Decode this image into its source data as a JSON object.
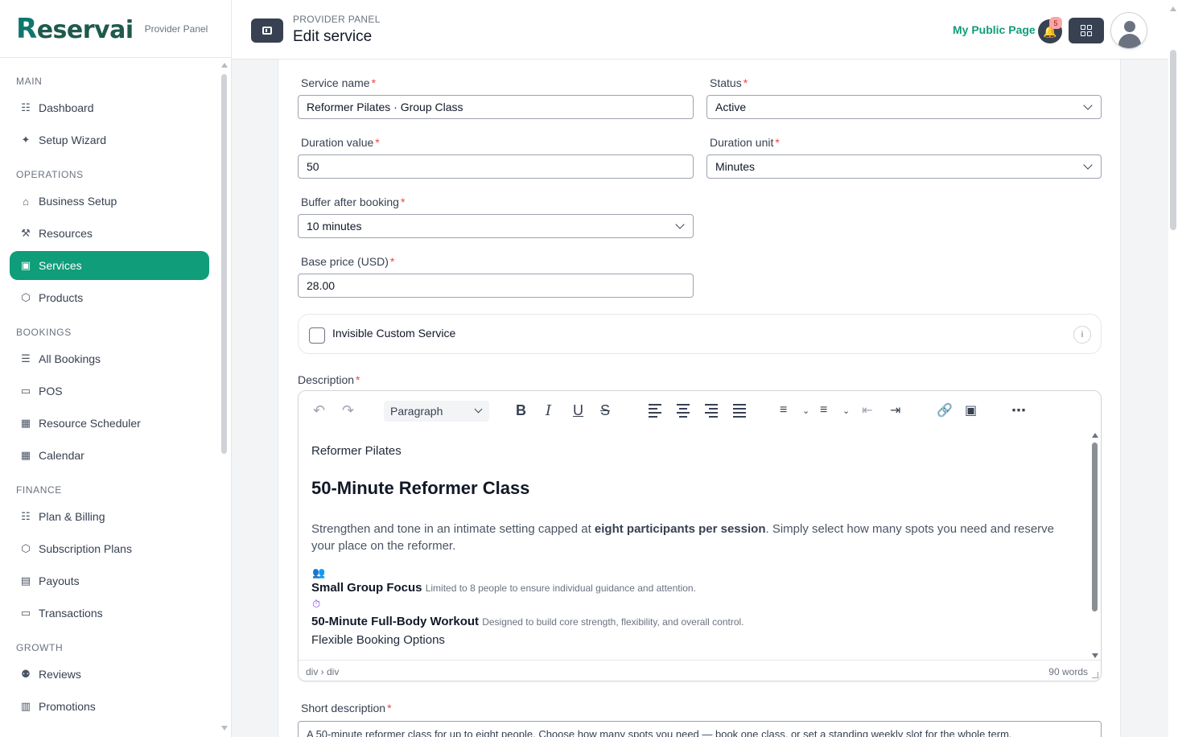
{
  "brand": {
    "logo": "Reservai",
    "subtitle": "Provider Panel"
  },
  "sidebar": {
    "sections": [
      {
        "title": "MAIN",
        "items": [
          {
            "label": "Dashboard",
            "icon": "grid-icon"
          },
          {
            "label": "Setup Wizard",
            "icon": "wand-icon"
          }
        ]
      },
      {
        "title": "OPERATIONS",
        "items": [
          {
            "label": "Business Setup",
            "icon": "store-icon"
          },
          {
            "label": "Resources",
            "icon": "wrench-icon"
          },
          {
            "label": "Services",
            "icon": "briefcase-icon",
            "active": true
          },
          {
            "label": "Products",
            "icon": "box-icon"
          }
        ]
      },
      {
        "title": "BOOKINGS",
        "items": [
          {
            "label": "All Bookings",
            "icon": "list-icon"
          },
          {
            "label": "POS",
            "icon": "card-icon"
          },
          {
            "label": "Resource Scheduler",
            "icon": "calendar-icon"
          },
          {
            "label": "Calendar",
            "icon": "calendar-icon"
          }
        ]
      },
      {
        "title": "FINANCE",
        "items": [
          {
            "label": "Plan & Billing",
            "icon": "receipt-icon"
          },
          {
            "label": "Subscription Plans",
            "icon": "box-icon"
          },
          {
            "label": "Payouts",
            "icon": "wallet-icon"
          },
          {
            "label": "Transactions",
            "icon": "card-icon"
          }
        ]
      },
      {
        "title": "GROWTH",
        "items": [
          {
            "label": "Reviews",
            "icon": "people-icon"
          },
          {
            "label": "Promotions",
            "icon": "ticket-icon"
          }
        ]
      }
    ]
  },
  "header": {
    "breadcrumb": "PROVIDER PANEL",
    "title": "Edit service",
    "public_link": "My Public Page",
    "notification_count": "5"
  },
  "form": {
    "service_name": {
      "label": "Service name",
      "value": "Reformer Pilates · Group Class"
    },
    "status": {
      "label": "Status",
      "value": "Active"
    },
    "duration_value": {
      "label": "Duration value",
      "value": "50"
    },
    "duration_unit": {
      "label": "Duration unit",
      "value": "Minutes"
    },
    "buffer": {
      "label": "Buffer after booking",
      "value": "10 minutes"
    },
    "base_price": {
      "label": "Base price (USD)",
      "value": "28.00"
    },
    "invisible": {
      "label": "Invisible Custom Service",
      "checked": false
    },
    "description": {
      "label": "Description",
      "block_format": "Paragraph",
      "line1": "Reformer Pilates",
      "heading": "50-Minute Reformer Class",
      "para_pre": "Strengthen and tone in an intimate setting capped at ",
      "para_bold": "eight participants per session",
      "para_post": ". Simply select how many spots you need and reserve your place on the reformer.",
      "feature1_title": "Small Group Focus",
      "feature1_desc": "Limited to 8 people to ensure individual guidance and attention.",
      "feature2_title": "50-Minute Full-Body Workout",
      "feature2_desc": "Designed to build core strength, flexibility, and overall control.",
      "line_last": "Flexible Booking Options",
      "path": "div › div",
      "word_count": "90 words"
    },
    "short_description": {
      "label": "Short description",
      "value": "A 50-minute reformer class for up to eight people. Choose how many spots you need — book one class, or set a standing weekly slot for the whole term."
    }
  }
}
